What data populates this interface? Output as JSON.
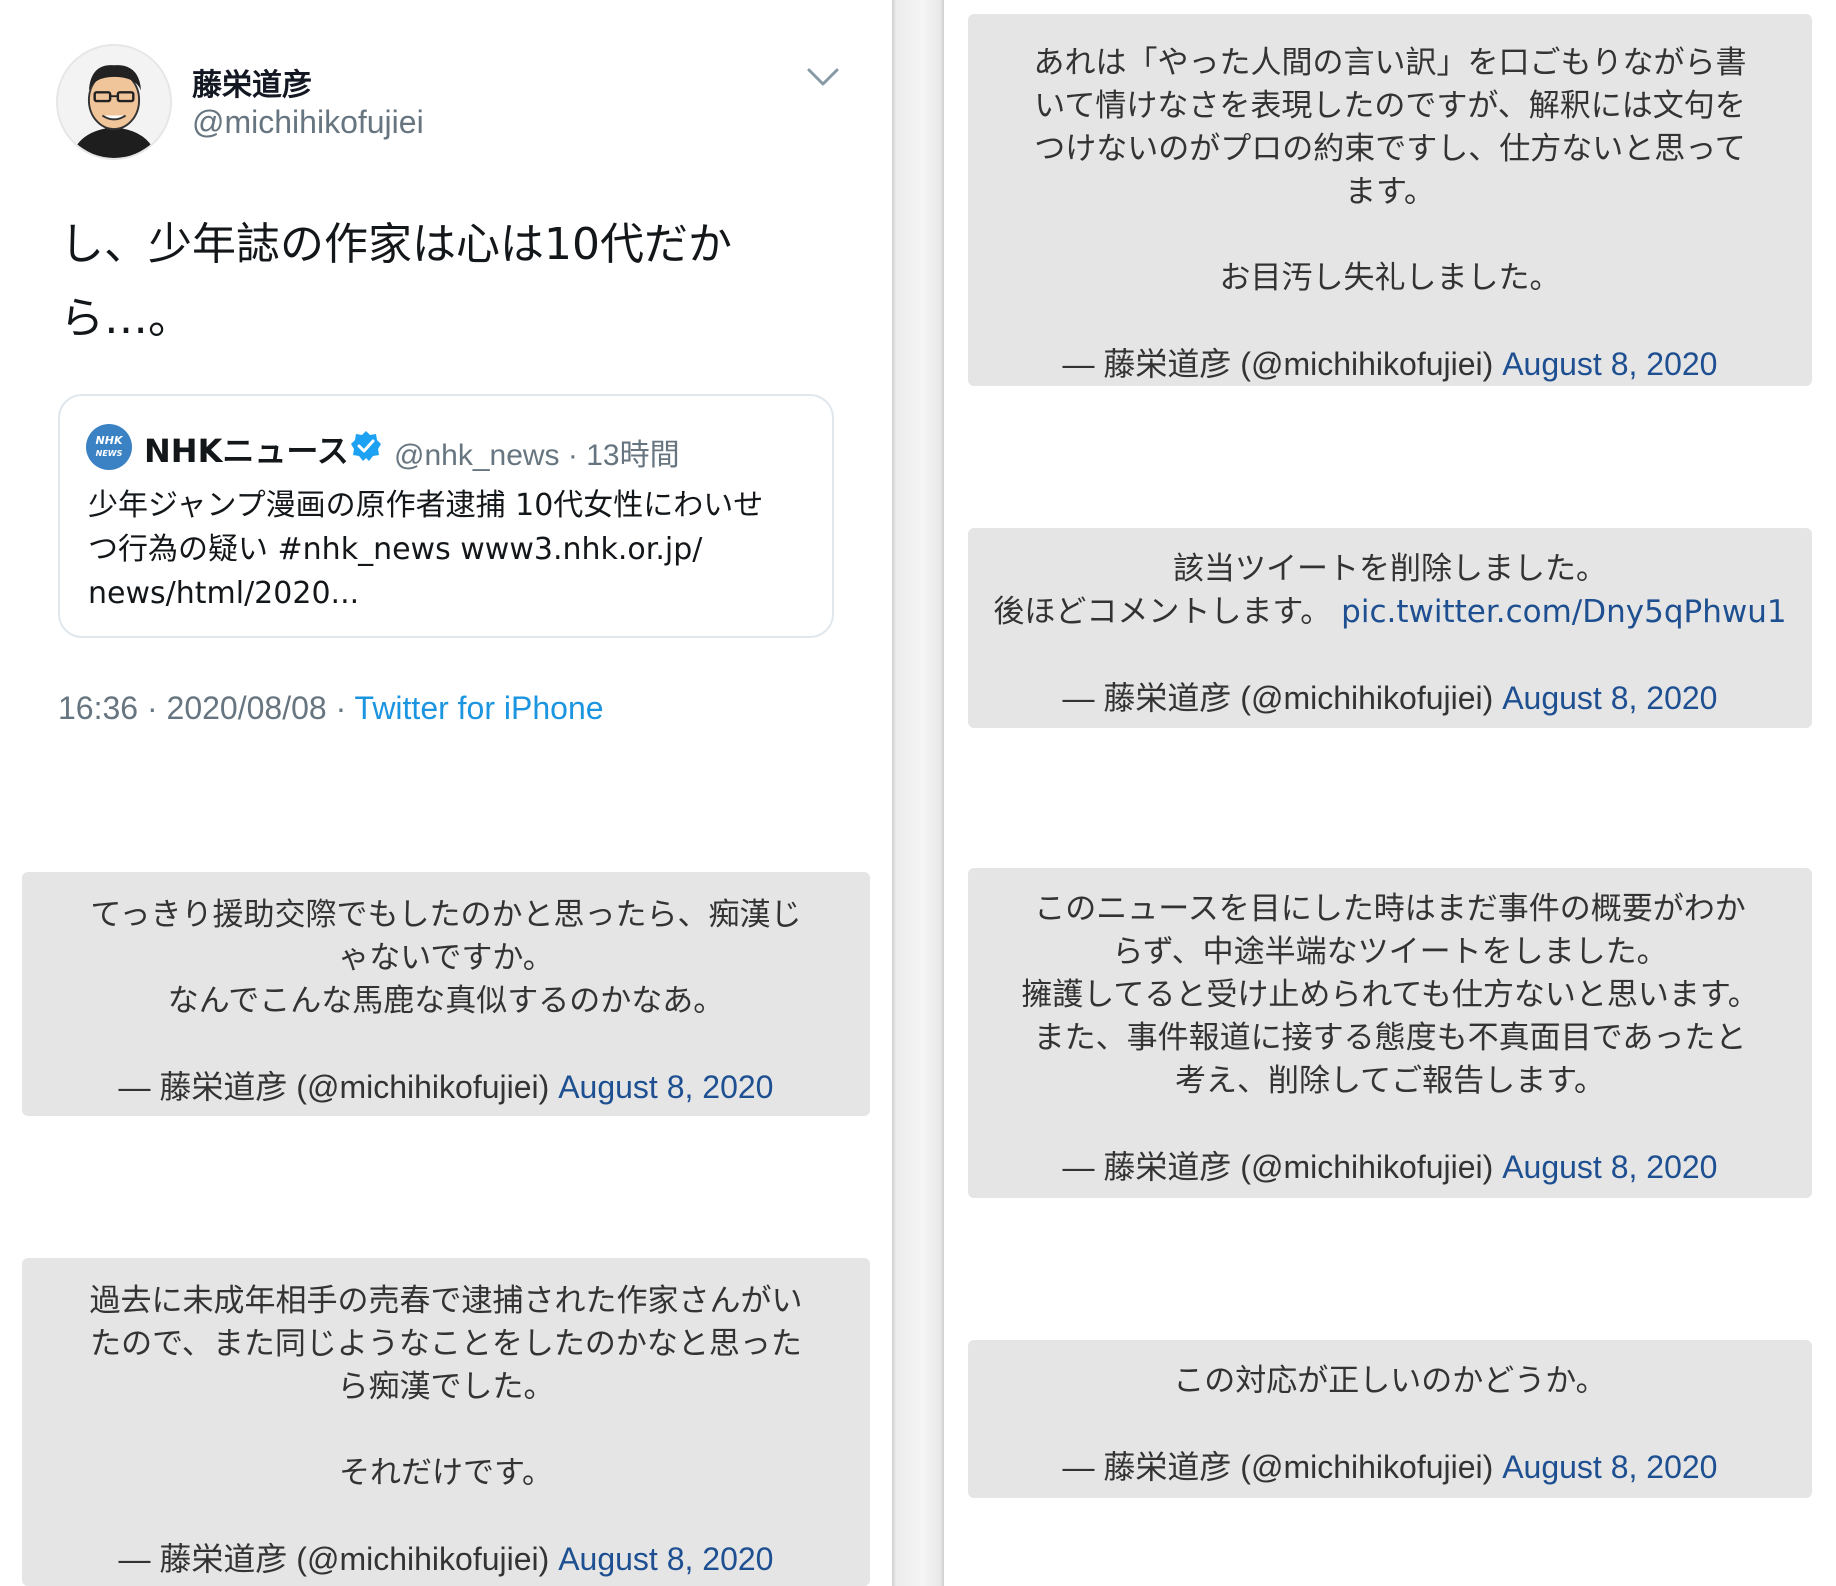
{
  "tweet": {
    "author_name": "藤栄道彦",
    "author_handle": "@michihikofujiei",
    "text_line1": "し、少年誌の作家は心は10代だか",
    "text_line2": "ら…。",
    "quoted": {
      "logo_text_1": "NHK",
      "logo_text_2": "NEWS",
      "name": "NHKニュース",
      "handle_time": "@nhk_news · 13時間",
      "body_line1": "少年ジャンプ漫画の原作者逮捕 10代女性にわいせ",
      "body_line2": "つ行為の疑い #nhk_news www3.nhk.or.jp/",
      "body_line3": "news/html/2020..."
    },
    "timestamp": "16:36 · 2020/08/08 · ",
    "source": "Twitter for iPhone"
  },
  "embeds_left": [
    {
      "lines": [
        "てっきり援助交際でもしたのかと思ったら、痴漢じ",
        "ゃないですか。",
        "なんでこんな馬鹿な真似するのかなあ。"
      ],
      "signature": "— 藤栄道彦 (@michihikofujiei) ",
      "date": "August 8, 2020"
    },
    {
      "lines": [
        "過去に未成年相手の売春で逮捕された作家さんがい",
        "たので、また同じようなことをしたのかなと思った",
        "ら痴漢でした。"
      ],
      "lines2": [
        "それだけです。"
      ],
      "signature": "— 藤栄道彦 (@michihikofujiei) ",
      "date": "August 8, 2020"
    }
  ],
  "embeds_right": [
    {
      "lines": [
        "あれは「やった人間の言い訳」を口ごもりながら書",
        "いて情けなさを表現したのですが、解釈には文句を",
        "つけないのがプロの約束ですし、仕方ないと思って",
        "ます。"
      ],
      "lines2": [
        "お目汚し失礼しました。"
      ],
      "signature": "— 藤栄道彦 (@michihikofujiei) ",
      "date": "August 8, 2020"
    },
    {
      "line1": "該当ツイートを削除しました。",
      "line2": "後ほどコメントします。 ",
      "link": "pic.twitter.com/Dny5qPhwu1",
      "signature": "— 藤栄道彦 (@michihikofujiei) ",
      "date": "August 8, 2020"
    },
    {
      "lines": [
        "このニュースを目にした時はまだ事件の概要がわか",
        "らず、中途半端なツイートをしました。",
        "擁護してると受け止められても仕方ないと思います。",
        "また、事件報道に接する態度も不真面目であったと",
        "考え、削除してご報告します。"
      ],
      "signature": "— 藤栄道彦 (@michihikofujiei) ",
      "date": "August 8, 2020"
    },
    {
      "lines": [
        "この対応が正しいのかどうか。"
      ],
      "signature": "— 藤栄道彦 (@michihikofujiei) ",
      "date": "August 8, 2020"
    }
  ],
  "colors": {
    "link": "#1d4f91",
    "source_link": "#1b95e0",
    "embed_bg": "#e5e5e5",
    "verified": "#1da1f2"
  }
}
